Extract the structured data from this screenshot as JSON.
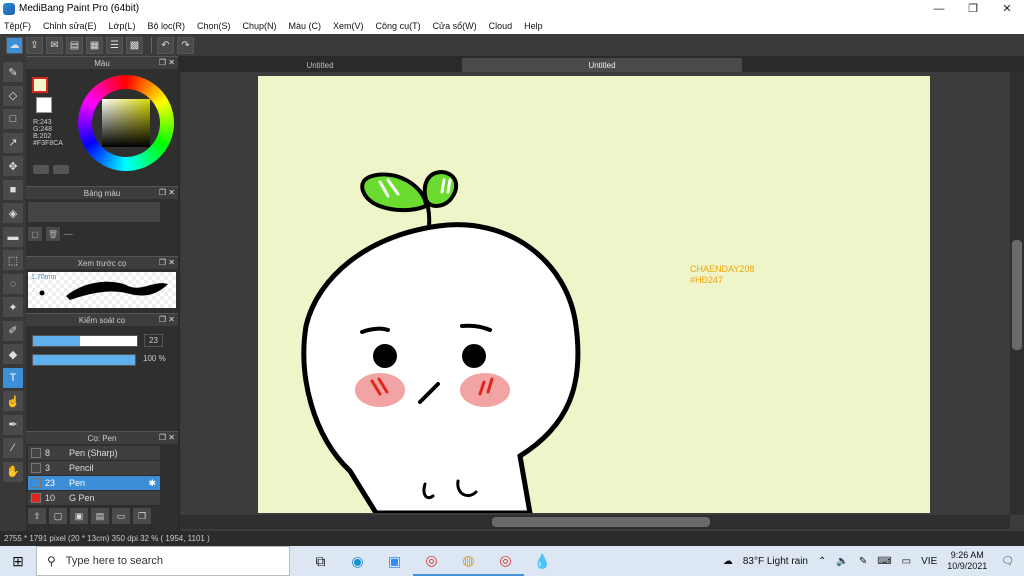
{
  "window": {
    "title": "MediBang Paint Pro (64bit)",
    "minimize": "—",
    "maximize": "❐",
    "close": "✕"
  },
  "menu": [
    "Tệp(F)",
    "Chỉnh sửa(E)",
    "Lớp(L)",
    "Bộ lọc(R)",
    "Chọn(S)",
    "Chụp(N)",
    "Màu (C)",
    "Xem(V)",
    "Công cụ(T)",
    "Cửa sổ(W)",
    "Cloud",
    "Help"
  ],
  "color_panel": {
    "title": "Màu",
    "fg_color": "#F3F8CA",
    "r": "R:243",
    "g": "G:248",
    "b": "B:202",
    "hex": "#F3F8CA"
  },
  "palette_panel": {
    "title": "Bảng màu",
    "placeholder": "---"
  },
  "preview_panel": {
    "title": "Xem trước cọ",
    "size": "1.70mm"
  },
  "brush_control": {
    "title": "Kiểm soát cọ",
    "size_value": "23",
    "size_percent": 0.45,
    "opacity_value": "100 %",
    "opacity_percent": 1.0
  },
  "brush_panel": {
    "title": "Cọ: Pen",
    "items": [
      {
        "num": "8",
        "name": "Pen (Sharp)",
        "color": "#444444",
        "selected": false
      },
      {
        "num": "3",
        "name": "Pencil",
        "color": "#444444",
        "selected": false
      },
      {
        "num": "23",
        "name": "Pen",
        "color": "#3c8fd6",
        "selected": true
      },
      {
        "num": "10",
        "name": "G Pen",
        "color": "#e0261c",
        "selected": false
      }
    ]
  },
  "doc_tabs": [
    "Untitled",
    "Untitled"
  ],
  "canvas": {
    "watermark_line1": "CHAENDAY208",
    "watermark_line2": "#HĐ247",
    "paper_color": "#f0f5c9"
  },
  "status": {
    "text": "2755 * 1791 pixel  (20 * 13cm)  350 dpi  32 %  ( 1954, 1101 )"
  },
  "taskbar": {
    "search_placeholder": "Type here to search",
    "weather": "83°F  Light rain",
    "lang": "VIE",
    "time": "9:26 AM",
    "date": "10/9/2021"
  }
}
